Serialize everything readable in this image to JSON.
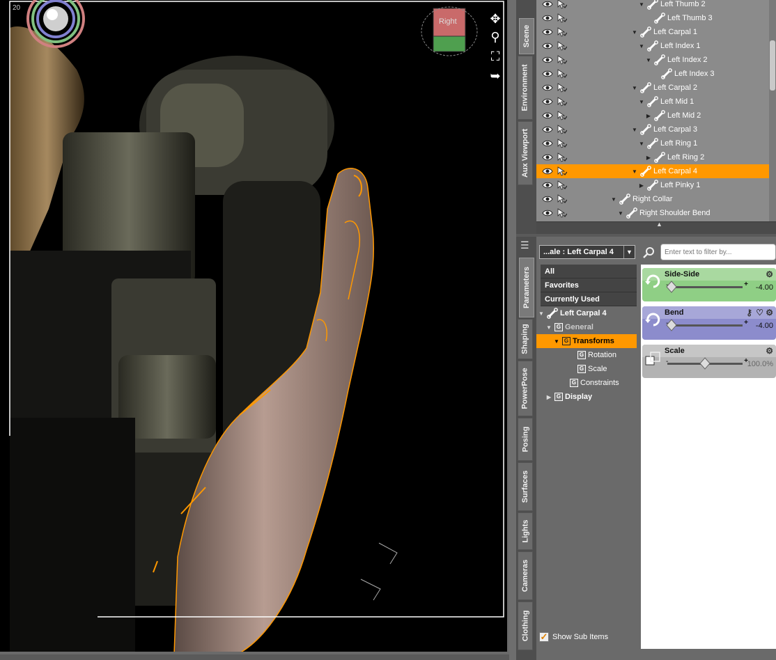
{
  "viewport": {
    "label": "20",
    "nav_cube_label": "Right",
    "tools": [
      "move-icon",
      "zoom-icon",
      "frame-icon",
      "reset-icon"
    ]
  },
  "upper_tabs": [
    {
      "label": "Scene",
      "active": true
    },
    {
      "label": "Environment",
      "active": false
    },
    {
      "label": "Aux Viewport",
      "active": false
    }
  ],
  "lower_tabs": [
    {
      "label": "Parameters",
      "active": true
    },
    {
      "label": "Shaping",
      "active": false
    },
    {
      "label": "PowerPose",
      "active": false
    },
    {
      "label": "Posing",
      "active": false
    },
    {
      "label": "Surfaces",
      "active": false
    },
    {
      "label": "Lights",
      "active": false
    },
    {
      "label": "Cameras",
      "active": false
    },
    {
      "label": "Clothing",
      "active": false
    }
  ],
  "scene_tree": [
    {
      "label": "Left Thumb 2",
      "depth": 4,
      "expander": "down",
      "selected": false
    },
    {
      "label": "Left Thumb 3",
      "depth": 5,
      "expander": "none",
      "selected": false
    },
    {
      "label": "Left Carpal 1",
      "depth": 3,
      "expander": "down",
      "selected": false
    },
    {
      "label": "Left Index 1",
      "depth": 4,
      "expander": "down",
      "selected": false
    },
    {
      "label": "Left Index 2",
      "depth": 5,
      "expander": "down",
      "selected": false
    },
    {
      "label": "Left Index 3",
      "depth": 6,
      "expander": "none",
      "selected": false
    },
    {
      "label": "Left Carpal 2",
      "depth": 3,
      "expander": "down",
      "selected": false
    },
    {
      "label": "Left Mid 1",
      "depth": 4,
      "expander": "down",
      "selected": false
    },
    {
      "label": "Left Mid 2",
      "depth": 5,
      "expander": "right",
      "selected": false
    },
    {
      "label": "Left Carpal 3",
      "depth": 3,
      "expander": "down",
      "selected": false
    },
    {
      "label": "Left Ring 1",
      "depth": 4,
      "expander": "down",
      "selected": false
    },
    {
      "label": "Left Ring 2",
      "depth": 5,
      "expander": "right",
      "selected": false
    },
    {
      "label": "Left Carpal 4",
      "depth": 3,
      "expander": "down",
      "selected": true
    },
    {
      "label": "Left Pinky 1",
      "depth": 4,
      "expander": "right",
      "selected": false
    },
    {
      "label": "Right Collar",
      "depth": 0,
      "expander": "down",
      "selected": false
    },
    {
      "label": "Right Shoulder Bend",
      "depth": 1,
      "expander": "down",
      "selected": false
    }
  ],
  "params": {
    "node_select": "...ale : Left Carpal 4",
    "filter_placeholder": "Enter text to filter by...",
    "categories": [
      "All",
      "Favorites",
      "Currently Used"
    ],
    "groups": [
      {
        "label": "Left Carpal 4",
        "indent": 0,
        "expander": "down",
        "icon": "bone-icon",
        "selected": false,
        "bold": true
      },
      {
        "label": "General",
        "indent": 1,
        "expander": "down",
        "icon": "group-icon",
        "selected": false,
        "bold": true
      },
      {
        "label": "Transforms",
        "indent": 2,
        "expander": "down",
        "icon": "group-icon",
        "selected": true,
        "bold": true
      },
      {
        "label": "Rotation",
        "indent": 4,
        "expander": "none",
        "icon": "group-icon",
        "selected": false,
        "bold": false
      },
      {
        "label": "Scale",
        "indent": 4,
        "expander": "none",
        "icon": "group-icon",
        "selected": false,
        "bold": false
      },
      {
        "label": "Constraints",
        "indent": 3,
        "expander": "none",
        "icon": "group-icon",
        "selected": false,
        "bold": false
      },
      {
        "label": "Display",
        "indent": 1,
        "expander": "right",
        "icon": "group-icon",
        "selected": false,
        "bold": true
      }
    ],
    "sliders": [
      {
        "label": "Side-Side",
        "value": "-4.00",
        "color": "#8fcf85",
        "head_color": "#a9d9a0",
        "level": 0.06,
        "icon": "rotate-icon"
      },
      {
        "label": "Bend",
        "value": "-4.00",
        "color": "#8c8ccc",
        "head_color": "#a7a7d8",
        "level": 0.06,
        "icon": "rotate-icon"
      },
      {
        "label": "Scale",
        "value": "100.0%",
        "color": "#b3b3b3",
        "head_color": "#c6c6c6",
        "level": 0.5,
        "icon": "scale-icon"
      }
    ],
    "show_sub_items": "Show Sub Items"
  },
  "colors": {
    "selection": "#ff9800",
    "panel_bg": "#8b8b8b"
  }
}
